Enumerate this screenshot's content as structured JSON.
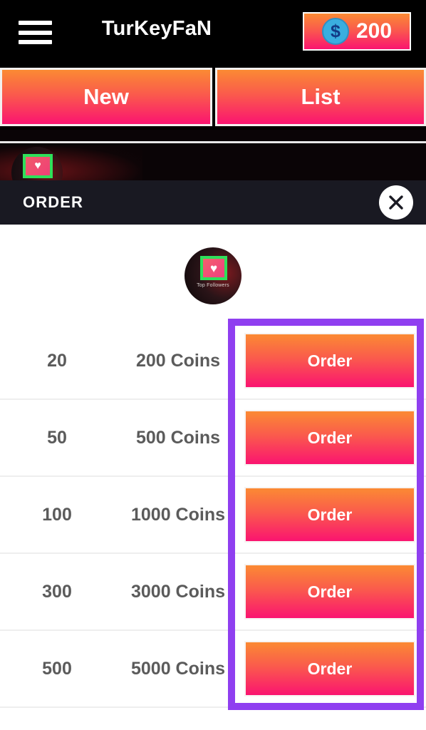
{
  "header": {
    "menu_icon": "hamburger-menu-icon",
    "title": "TurKeyFaN",
    "coin_icon": "dollar-coin-icon",
    "coin_symbol": "$",
    "coin_amount": "200"
  },
  "tabs": [
    {
      "label": "New",
      "name": "tab-new"
    },
    {
      "label": "List",
      "name": "tab-list"
    }
  ],
  "background": {
    "avatar_icon": "top-followers-avatar-icon",
    "heart_glyph": "♥"
  },
  "modal": {
    "title": "ORDER",
    "close_icon": "close-x-icon",
    "logo": {
      "heart_glyph": "♥",
      "caption": "Top Followers",
      "name": "top-followers-logo"
    },
    "rows": [
      {
        "quantity": "20",
        "coins": "200 Coins",
        "action": "Order"
      },
      {
        "quantity": "50",
        "coins": "500 Coins",
        "action": "Order"
      },
      {
        "quantity": "100",
        "coins": "1000 Coins",
        "action": "Order"
      },
      {
        "quantity": "300",
        "coins": "3000 Coins",
        "action": "Order"
      },
      {
        "quantity": "500",
        "coins": "5000 Coins",
        "action": "Order"
      }
    ]
  },
  "annotation": {
    "name": "order-column-highlight",
    "color": "#8f3ff0"
  },
  "colors": {
    "gradient_start": "#fb8a33",
    "gradient_mid": "#fa5b4c",
    "gradient_end": "#fa1470",
    "appbar_bg": "#000000",
    "modal_header_bg": "#191922",
    "body_bg": "#ffffff",
    "row_text": "#5b5b5b",
    "divider": "#eeeeee",
    "coin_blue": "#3aaee0",
    "annotation_purple": "#8f3ff0"
  }
}
